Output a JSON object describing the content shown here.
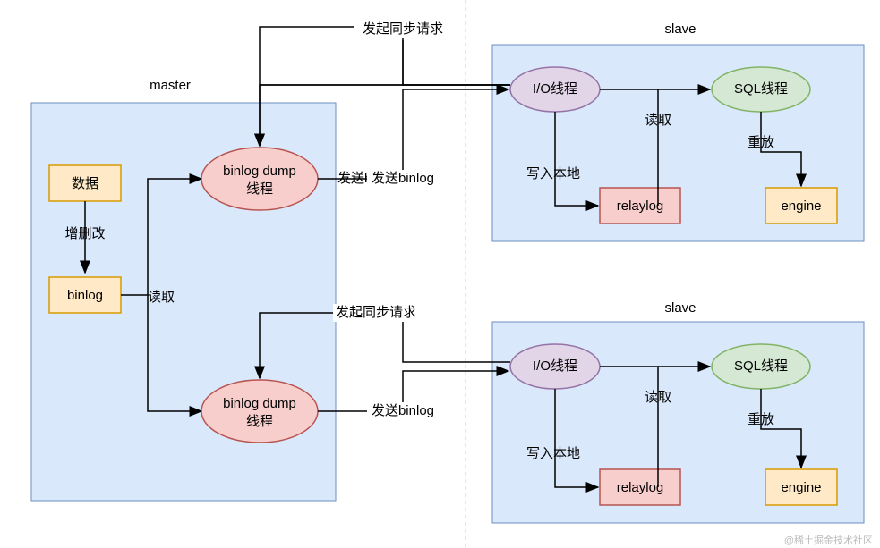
{
  "master": {
    "title": "master",
    "data_box": "数据",
    "crud_label": "增删改",
    "binlog_box": "binlog",
    "read_label": "读取",
    "dump1_l1": "binlog dump",
    "dump1_l2": "线程",
    "dump2_l1": "binlog dump",
    "dump2_l2": "线程"
  },
  "connectors": {
    "sync_request_1": "发起同步请求",
    "send_binlog_1": "发送binlog",
    "sync_request_2": "发起同步请求",
    "send_binlog_2": "发送binlog"
  },
  "slave1": {
    "title": "slave",
    "io_thread": "I/O线程",
    "sql_thread": "SQL线程",
    "write_local": "写入本地",
    "read": "读取",
    "replay": "重放",
    "relaylog": "relaylog",
    "engine": "engine"
  },
  "slave2": {
    "title": "slave",
    "io_thread": "I/O线程",
    "sql_thread": "SQL线程",
    "write_local": "写入本地",
    "read": "读取",
    "replay": "重放",
    "relaylog": "relaylog",
    "engine": "engine"
  },
  "watermark": "@稀土掘金技术社区"
}
